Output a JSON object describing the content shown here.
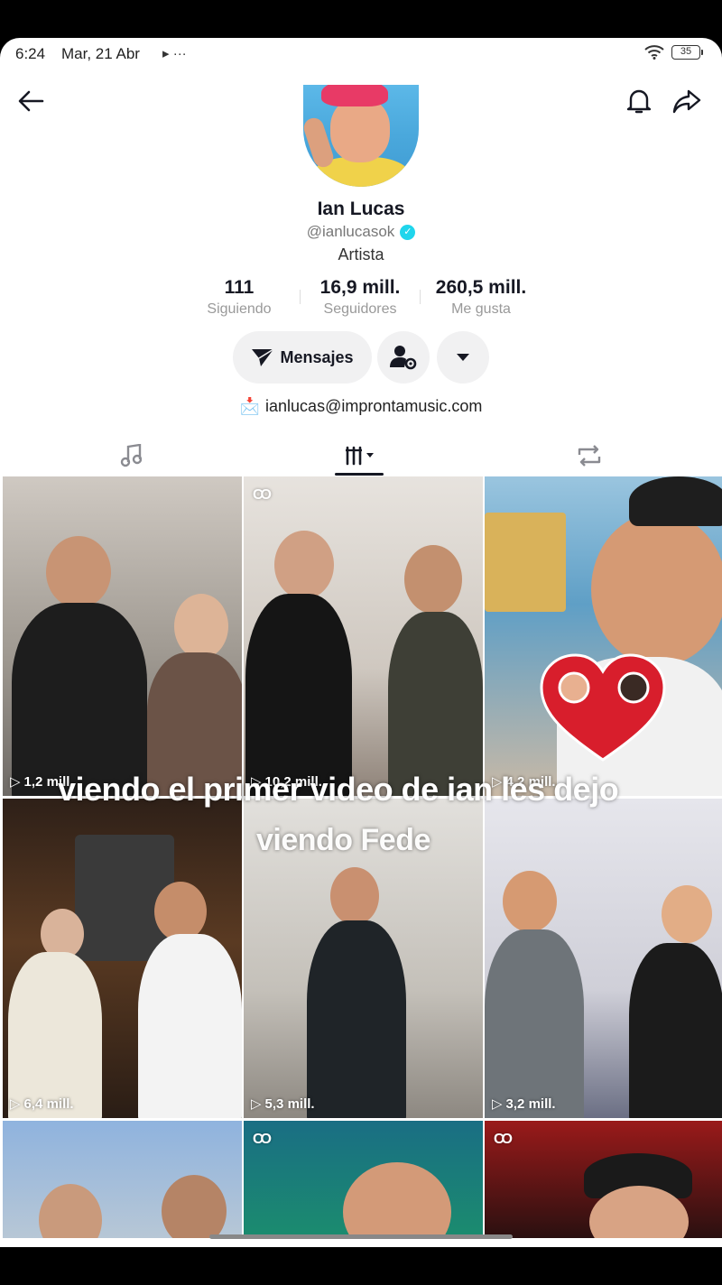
{
  "status_bar": {
    "time": "6:24",
    "date": "Mar, 21 Abr",
    "extra": "▸ ···",
    "battery": "35"
  },
  "profile": {
    "name": "Ian Lucas",
    "handle": "@ianlucasok",
    "category": "Artista",
    "email": "ianlucas@improntamusic.com",
    "email_icon": "📩",
    "verified_icon": "✓"
  },
  "stats": [
    {
      "value": "111",
      "label": "Siguiendo"
    },
    {
      "value": "16,9 mill.",
      "label": "Seguidores"
    },
    {
      "value": "260,5 mill.",
      "label": "Me gusta"
    }
  ],
  "actions": {
    "messages_label": "Mensajes"
  },
  "tabs": {
    "music": "music-icon",
    "videos": "videos-grid-icon",
    "reposts": "repost-icon"
  },
  "videos": [
    {
      "views": "1,2 mill.",
      "collab": ""
    },
    {
      "views": "10,2 mill.",
      "collab": "CO"
    },
    {
      "views": "4,2 mill.",
      "collab": ""
    },
    {
      "views": "6,4 mill.",
      "collab": ""
    },
    {
      "views": "5,3 mill.",
      "collab": ""
    },
    {
      "views": "3,2 mill.",
      "collab": ""
    },
    {
      "views": "",
      "collab": ""
    },
    {
      "views": "",
      "collab": "CO"
    },
    {
      "views": "",
      "collab": "CO"
    }
  ],
  "overlays": {
    "line1": "viendo el primer video de ian les dejo",
    "line2": "viendo Fede"
  },
  "colors": {
    "accent_verified": "#20d5ec",
    "button_bg": "#f1f1f2",
    "text": "#161823"
  }
}
